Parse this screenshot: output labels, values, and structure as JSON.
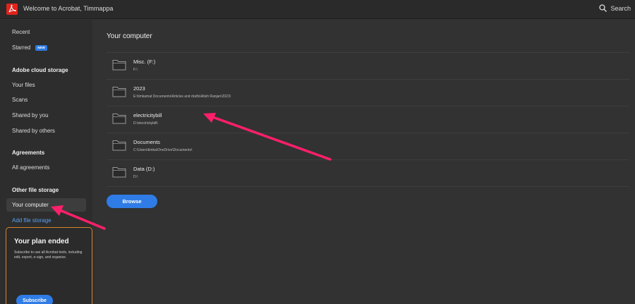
{
  "app": {
    "title": "Welcome to Acrobat, Timmappa",
    "search_label": "Search",
    "logo_icon": "acrobat-logo-icon",
    "accent_color": "#2f7ce6",
    "logo_color": "#e0231c"
  },
  "sidebar": {
    "recent": "Recent",
    "starred": "Starred",
    "new_badge": "NEW",
    "cloud_title": "Adobe cloud storage",
    "your_files": "Your files",
    "scans": "Scans",
    "shared_by_you": "Shared by you",
    "shared_by_others": "Shared by others",
    "agreements_title": "Agreements",
    "all_agreements": "All agreements",
    "other_title": "Other file storage",
    "your_computer": "Your computer",
    "add_file_storage": "Add file storage"
  },
  "plan": {
    "title": "Your plan ended",
    "text": "Subscribe to use all Acrobat tools, including edit, export, e-sign, and organize.",
    "button": "Subscribe",
    "border_color": "#d9822b"
  },
  "main": {
    "title": "Your computer",
    "folders": [
      {
        "name": "Misc. (F:)",
        "path": "F:\\"
      },
      {
        "name": "2023",
        "path": "E:\\timkamat Documents\\Articles and drafts\\Atish Ranjan\\2023\\"
      },
      {
        "name": "electricitybill",
        "path": "D:\\electricitybill\\"
      },
      {
        "name": "Documents",
        "path": "C:\\Users\\timka\\OneDrive\\Documents\\"
      },
      {
        "name": "Data (D:)",
        "path": "D:\\"
      }
    ],
    "browse": "Browse"
  },
  "annotation_color": "#ff1f6b"
}
